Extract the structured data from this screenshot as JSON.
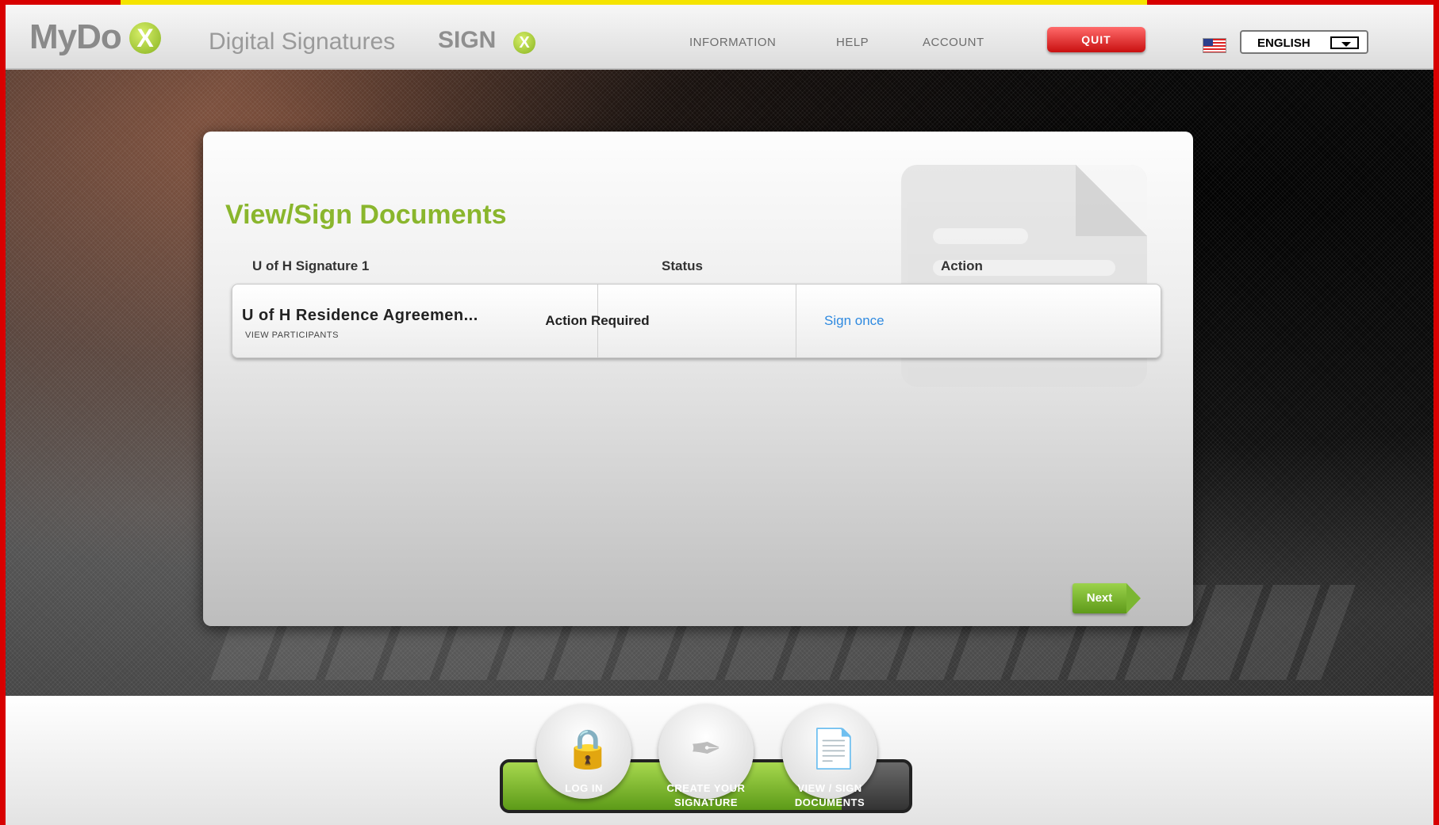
{
  "header": {
    "logo_text": "MyDo",
    "logo_mark": "X",
    "logo_subtitle": "Digital Signatures",
    "powered_by_logo": "SIGN",
    "powered_by_mark": "X",
    "nav": {
      "information": "INFORMATION",
      "help": "HELP",
      "account": "ACCOUNT"
    },
    "quit_label": "QUIT",
    "flag_icon": "us-flag-icon",
    "language": "ENGLISH"
  },
  "panel": {
    "title": "View/Sign Documents",
    "columns": {
      "name": "U of H Signature 1",
      "status": "Status",
      "action": "Action"
    },
    "rows": [
      {
        "document": "U of H Residence Agreemen...",
        "sub_link": "VIEW PARTICIPANTS",
        "status": "Action Required",
        "action": "Sign once"
      }
    ],
    "next_label": "Next"
  },
  "progress": {
    "current_step": 3,
    "total_steps": 3,
    "steps": [
      {
        "label_line1": "LOG IN",
        "label_line2": "",
        "icon": "lock-icon"
      },
      {
        "label_line1": "CREATE YOUR",
        "label_line2": "SIGNATURE",
        "icon": "pen-icon"
      },
      {
        "label_line1": "VIEW / SIGN",
        "label_line2": "DOCUMENTS",
        "icon": "document-icon"
      }
    ]
  },
  "colors": {
    "brand_green": "#8ab62d",
    "quit_red": "#c91010",
    "link_blue": "#2f8ae0"
  }
}
